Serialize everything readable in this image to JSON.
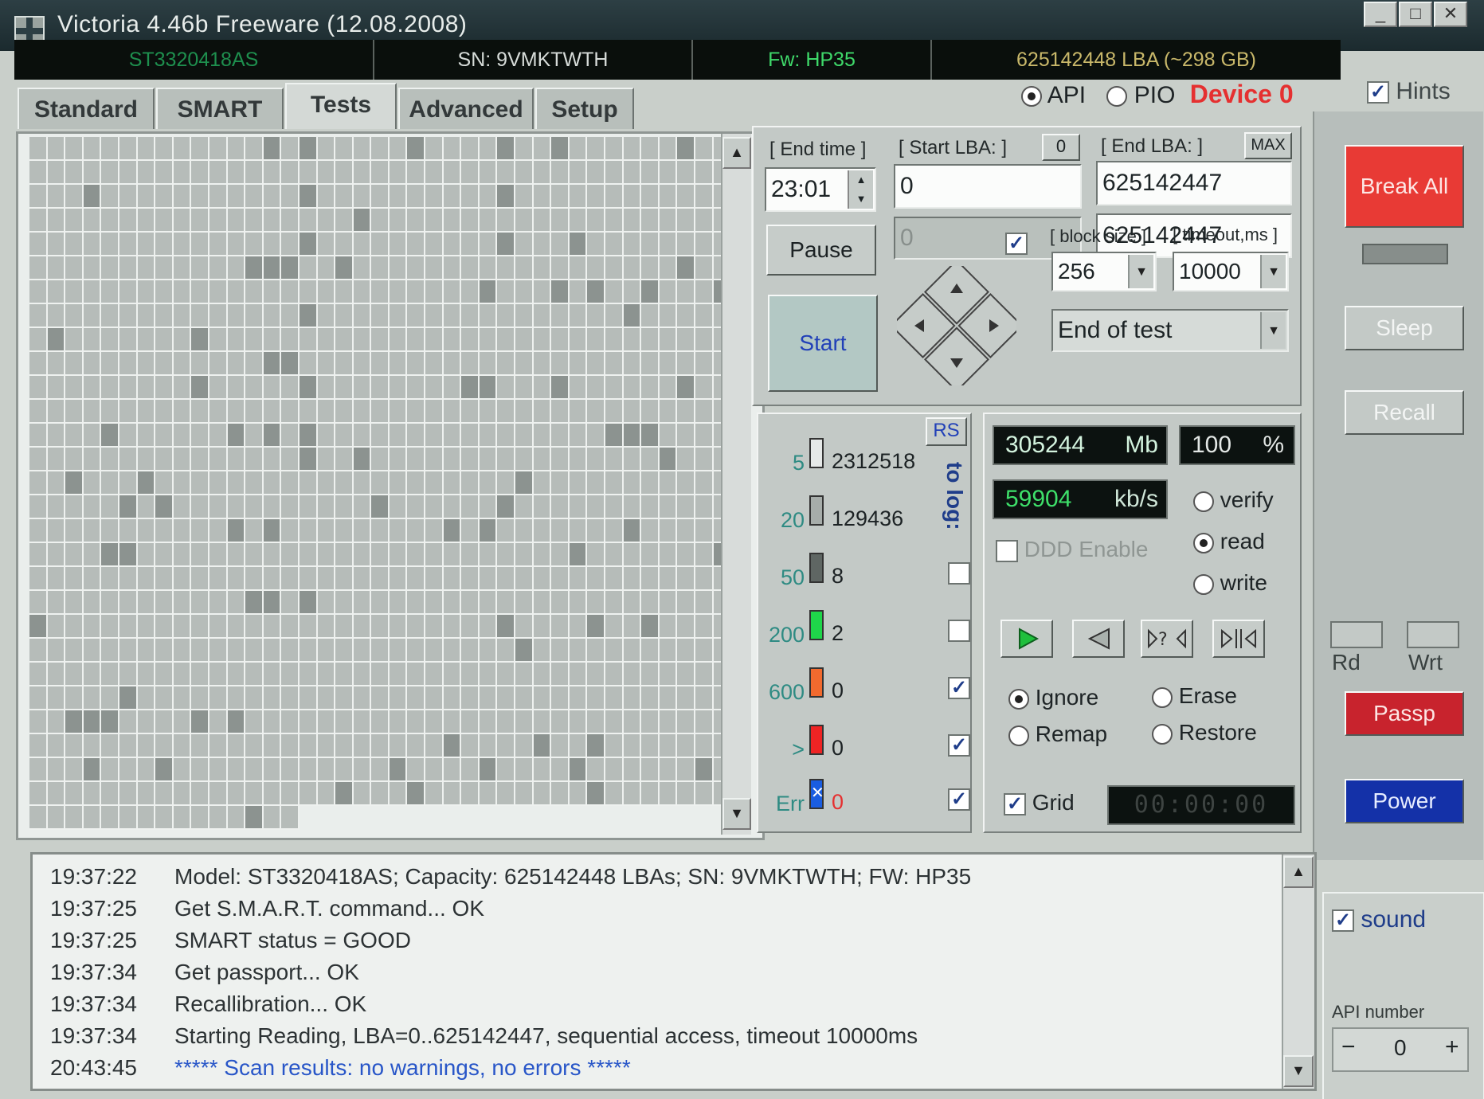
{
  "window": {
    "title": "Victoria 4.46b Freeware (12.08.2008)",
    "buttons": [
      "_",
      "□",
      "✕"
    ]
  },
  "info_strip": {
    "model": "ST3320418AS",
    "serial": "SN: 9VMKTWTH",
    "firmware": "Fw: HP35",
    "capacity": "625142448 LBA (~298 GB)"
  },
  "tabs": [
    {
      "label": "Standard",
      "active": false
    },
    {
      "label": "SMART",
      "active": false
    },
    {
      "label": "Tests",
      "active": true
    },
    {
      "label": "Advanced",
      "active": false
    },
    {
      "label": "Setup",
      "active": false
    }
  ],
  "mode": {
    "api_label": "API",
    "pio_label": "PIO",
    "selected": "API",
    "device_label": "Device 0",
    "device_color": "#e53030"
  },
  "hints": {
    "label": "Hints",
    "checked": true
  },
  "scan": {
    "end_time_label": "[ End time ]",
    "end_time_value": "23:01",
    "start_lba_label": "[ Start LBA: ]",
    "start_lba_zero_btn": "0",
    "start_lba_value": "0",
    "start_lba_current": "0",
    "end_lba_label": "[ End LBA: ]",
    "end_lba_max_btn": "MAX",
    "end_lba_value": "625142447",
    "end_lba_current": "625142447",
    "pause_label": "Pause",
    "start_label": "Start",
    "block_size_label": "[ block size ]",
    "block_size_value": "256",
    "timeout_label": "[ timeout,ms ]",
    "timeout_value": "10000",
    "end_action_value": "End of test",
    "nav_checkbox": true
  },
  "legend": {
    "rs_label": "RS",
    "to_log_label": "to log:",
    "rows": [
      {
        "threshold": "5",
        "count": "2312518",
        "color": "#e6e9e8",
        "log": null
      },
      {
        "threshold": "20",
        "count": "129436",
        "color": "#a7adaa",
        "log": null
      },
      {
        "threshold": "50",
        "count": "8",
        "color": "#5f6663",
        "log": false
      },
      {
        "threshold": "200",
        "count": "2",
        "color": "#1fd64a",
        "log": false
      },
      {
        "threshold": "600",
        "count": "0",
        "color": "#f26a2e",
        "log": true
      },
      {
        "threshold": ">",
        "count": "0",
        "color": "#ee2424",
        "log": true
      },
      {
        "threshold": "Err",
        "count": "0",
        "color": "#1a5de0",
        "log": true
      }
    ]
  },
  "stats": {
    "size_value": "305244",
    "size_unit": "Mb",
    "percent_value": "100",
    "percent_unit": "%",
    "speed_value": "59904",
    "speed_unit": "kb/s",
    "ddd_label": "DDD Enable",
    "ddd_checked": false
  },
  "test_mode": {
    "options": [
      "verify",
      "read",
      "write"
    ],
    "selected": "read"
  },
  "action_mode": {
    "options": [
      "Ignore",
      "Erase",
      "Remap",
      "Restore"
    ],
    "selected": "Ignore"
  },
  "grid": {
    "label": "Grid",
    "checked": true,
    "timer": "00:00:00"
  },
  "side": {
    "break_all": "Break All",
    "sleep": "Sleep",
    "recall": "Recall",
    "rd": "Rd",
    "wrt": "Wrt",
    "passp": "Passp",
    "power": "Power",
    "sound_label": "sound",
    "sound_checked": true,
    "api_number_label": "API number",
    "api_number_value": "0",
    "minus": "−",
    "plus": "+"
  },
  "log": [
    {
      "time": "19:37:22",
      "text": "Model: ST3320418AS; Capacity: 625142448 LBAs; SN: 9VMKTWTH; FW: HP35",
      "blue": false
    },
    {
      "time": "19:37:25",
      "text": "Get S.M.A.R.T. command... OK",
      "blue": false
    },
    {
      "time": "19:37:25",
      "text": "SMART status = GOOD",
      "blue": false
    },
    {
      "time": "19:37:34",
      "text": "Get passport... OK",
      "blue": false
    },
    {
      "time": "19:37:34",
      "text": "Recallibration... OK",
      "blue": false
    },
    {
      "time": "19:37:34",
      "text": "Starting Reading, LBA=0..625142447, sequential access, timeout 10000ms",
      "blue": false
    },
    {
      "time": "20:43:45",
      "text": "***** Scan results: no warnings, no errors *****",
      "blue": true
    }
  ]
}
